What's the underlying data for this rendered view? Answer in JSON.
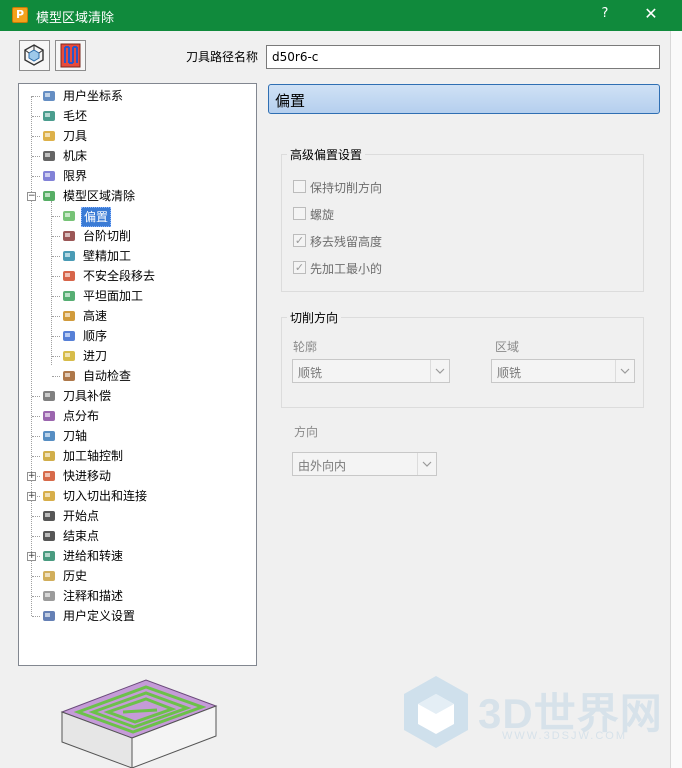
{
  "window": {
    "title": "模型区域清除",
    "app_icon": "P",
    "help": "?",
    "close": "✕"
  },
  "toolbar": {
    "button1_icon": "collision-check-icon",
    "button2_icon": "toolpath-icon",
    "path_label": "刀具路径名称",
    "path_value": "d50r6-c"
  },
  "tree": {
    "items": [
      {
        "label": "用户坐标系",
        "icon": "user-coordinate-icon"
      },
      {
        "label": "毛坯",
        "icon": "block-icon"
      },
      {
        "label": "刀具",
        "icon": "tool-icon"
      },
      {
        "label": "机床",
        "icon": "machine-icon"
      },
      {
        "label": "限界",
        "icon": "limits-icon"
      },
      {
        "label": "模型区域清除",
        "icon": "model-area-clearance-icon"
      },
      {
        "label": "偏置",
        "icon": "offset-icon"
      },
      {
        "label": "台阶切削",
        "icon": "step-cutting-icon"
      },
      {
        "label": "壁精加工",
        "icon": "wall-finishing-icon"
      },
      {
        "label": "不安全段移去",
        "icon": "unsafe-segment-icon"
      },
      {
        "label": "平坦面加工",
        "icon": "flat-machining-icon"
      },
      {
        "label": "高速",
        "icon": "high-speed-icon"
      },
      {
        "label": "顺序",
        "icon": "order-icon"
      },
      {
        "label": "进刀",
        "icon": "plunge-icon"
      },
      {
        "label": "自动检查",
        "icon": "auto-check-icon"
      },
      {
        "label": "刀具补偿",
        "icon": "tool-compensation-icon"
      },
      {
        "label": "点分布",
        "icon": "point-distribution-icon"
      },
      {
        "label": "刀轴",
        "icon": "tool-axis-icon"
      },
      {
        "label": "加工轴控制",
        "icon": "axis-control-icon"
      },
      {
        "label": "快进移动",
        "icon": "rapid-move-icon"
      },
      {
        "label": "切入切出和连接",
        "icon": "leads-links-icon"
      },
      {
        "label": "开始点",
        "icon": "start-point-icon"
      },
      {
        "label": "结束点",
        "icon": "end-point-icon"
      },
      {
        "label": "进给和转速",
        "icon": "feeds-speeds-icon"
      },
      {
        "label": "历史",
        "icon": "history-icon"
      },
      {
        "label": "注释和描述",
        "icon": "notes-icon"
      },
      {
        "label": "用户定义设置",
        "icon": "user-settings-icon"
      }
    ]
  },
  "panel": {
    "header": "偏置",
    "advanced": {
      "title": "高级偏置设置",
      "options": [
        {
          "label": "保持切削方向",
          "checked": false
        },
        {
          "label": "螺旋",
          "checked": false
        },
        {
          "label": "移去残留高度",
          "checked": true
        },
        {
          "label": "先加工最小的",
          "checked": true
        }
      ]
    },
    "cut_direction": {
      "title": "切削方向",
      "profile_label": "轮廓",
      "profile_value": "顺铣",
      "area_label": "区域",
      "area_value": "顺铣"
    },
    "direction": {
      "label": "方向",
      "value": "由外向内"
    }
  },
  "watermark": {
    "text": "3D世界网",
    "url": "WWW.3DSJW.COM"
  },
  "colors": {
    "titlebar": "#108a3c",
    "selection": "#3a7bd5",
    "header_border": "#2f6fb3",
    "preview_stripe": "#c59bd8",
    "preview_path": "#6cc14a"
  }
}
